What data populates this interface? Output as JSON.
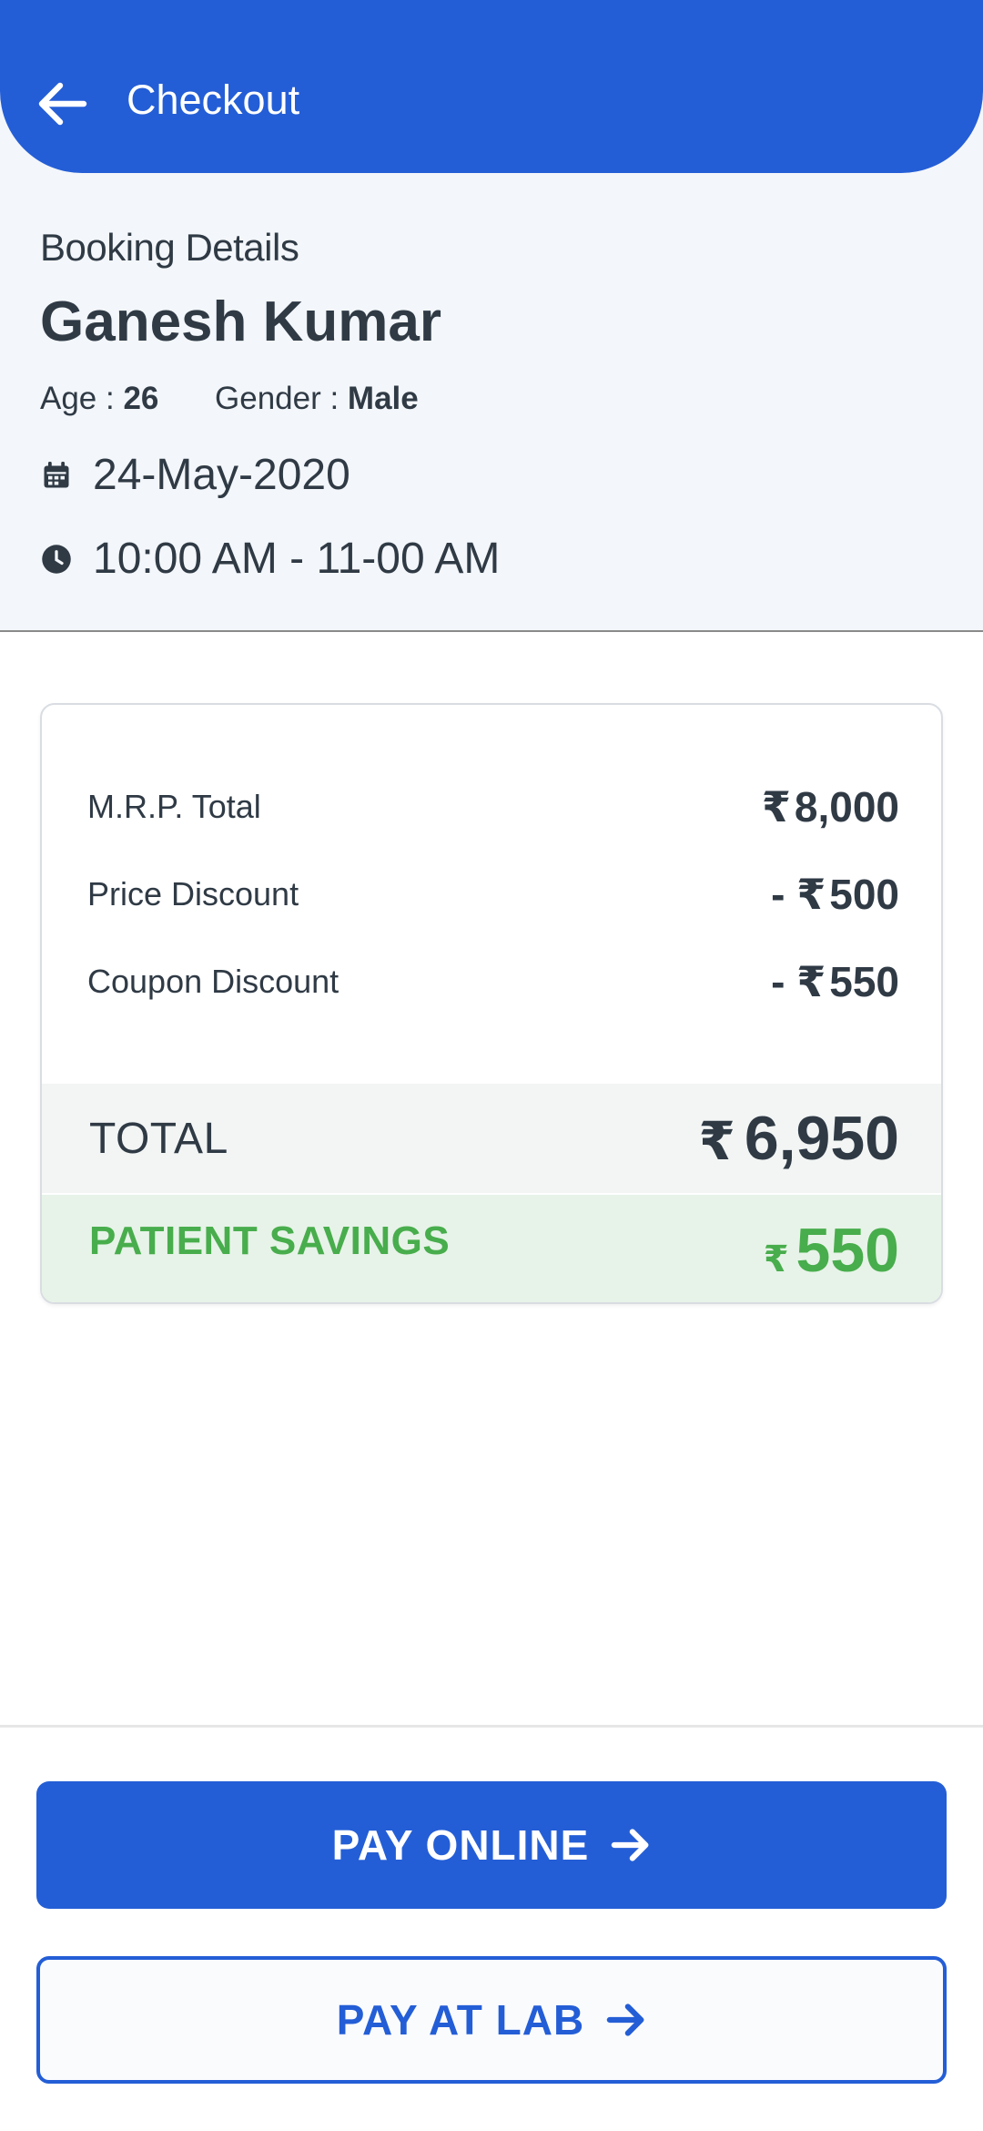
{
  "header": {
    "title": "Checkout",
    "back_icon": "arrow-left-icon",
    "color": "#245ed6"
  },
  "booking": {
    "heading": "Booking Details",
    "patient_name": "Ganesh Kumar",
    "age_label": "Age : ",
    "age_value": "26",
    "gender_label": "Gender : ",
    "gender_value": "Male",
    "date": "24-May-2020",
    "date_icon": "calendar-icon",
    "time": "10:00 AM - 11-00 AM",
    "time_icon": "clock-icon"
  },
  "summary": {
    "currency": "₹",
    "lines": [
      {
        "label": "M.R.P. Total",
        "prefix": "",
        "amount": "8,000"
      },
      {
        "label": "Price Discount",
        "prefix": "- ",
        "amount": "500"
      },
      {
        "label": "Coupon Discount",
        "prefix": "- ",
        "amount": "550"
      }
    ],
    "total_label": "TOTAL",
    "total_amount": "6,950",
    "savings_label": "PATIENT SAVINGS",
    "savings_amount": "550",
    "savings_color": "#48ad4c"
  },
  "actions": {
    "pay_online_label": "PAY ONLINE",
    "pay_at_lab_label": "PAY AT LAB",
    "arrow_icon": "arrow-right-icon"
  }
}
